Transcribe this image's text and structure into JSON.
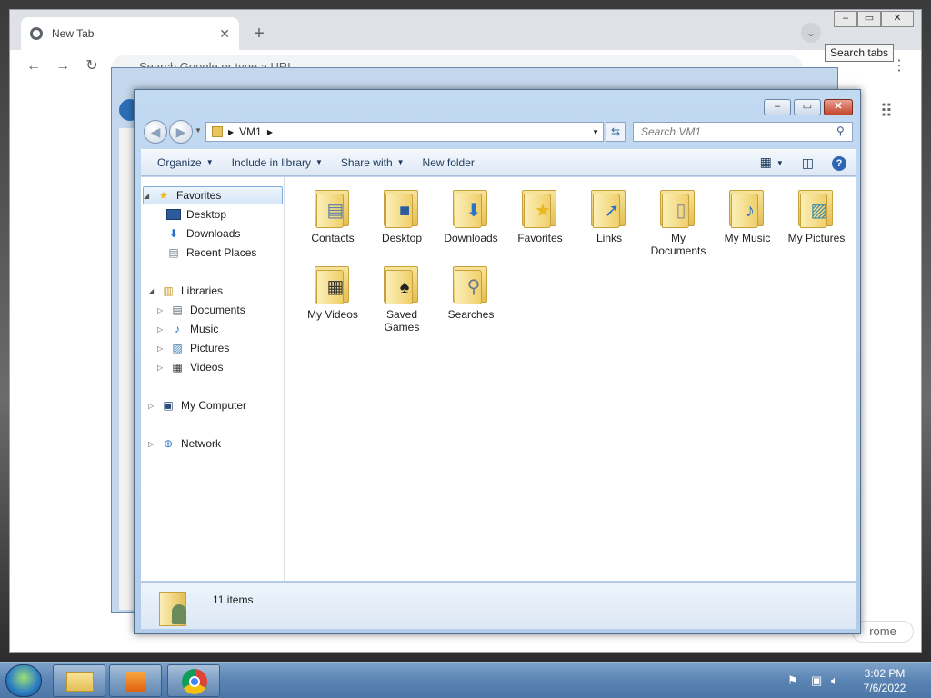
{
  "chrome": {
    "tab_title": "New Tab",
    "omnibox_placeholder": "Search Google or type a URL",
    "tooltip": "Search tabs",
    "cta_text": "rome"
  },
  "explorer": {
    "breadcrumb": "VM1",
    "search_placeholder": "Search VM1",
    "commands": [
      "Organize",
      "Include in library",
      "Share with",
      "New folder"
    ],
    "nav": {
      "favorites": "Favorites",
      "favorites_items": [
        "Desktop",
        "Downloads",
        "Recent Places"
      ],
      "libraries": "Libraries",
      "libraries_items": [
        "Documents",
        "Music",
        "Pictures",
        "Videos"
      ],
      "computer": "My Computer",
      "network": "Network"
    },
    "folders": [
      {
        "name": "Contacts",
        "icon": "contact-card-icon"
      },
      {
        "name": "Desktop",
        "icon": "desktop-icon"
      },
      {
        "name": "Downloads",
        "icon": "download-arrow-icon"
      },
      {
        "name": "Favorites",
        "icon": "star-icon"
      },
      {
        "name": "Links",
        "icon": "link-arrow-icon"
      },
      {
        "name": "My Documents",
        "icon": "document-icon"
      },
      {
        "name": "My Music",
        "icon": "music-note-icon"
      },
      {
        "name": "My Pictures",
        "icon": "picture-icon"
      },
      {
        "name": "My Videos",
        "icon": "film-icon"
      },
      {
        "name": "Saved Games",
        "icon": "chess-piece-icon"
      },
      {
        "name": "Searches",
        "icon": "magnifier-icon"
      }
    ],
    "status_text": "11 items"
  },
  "taskbar": {
    "time": "3:02 PM",
    "date": "7/6/2022"
  }
}
